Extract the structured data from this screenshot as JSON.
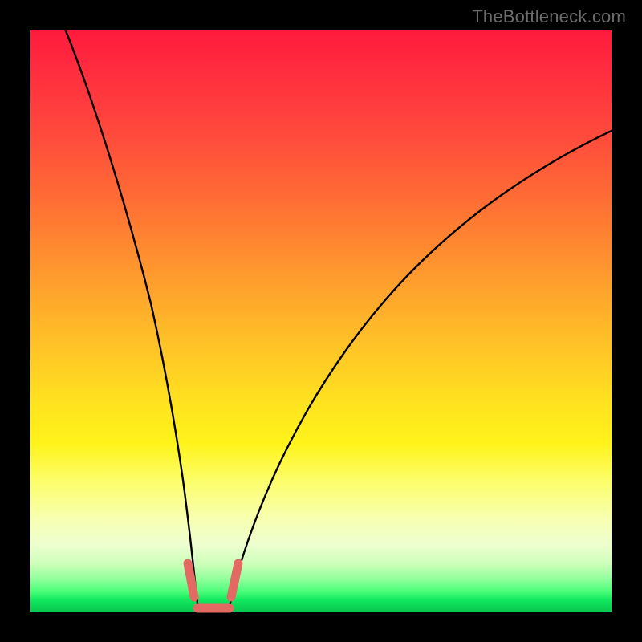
{
  "watermark": "TheBottleneck.com",
  "chart_data": {
    "type": "line",
    "title": "",
    "xlabel": "",
    "ylabel": "",
    "xlim": [
      0,
      100
    ],
    "ylim": [
      0,
      100
    ],
    "series": [
      {
        "name": "left-branch",
        "x": [
          6,
          8,
          10,
          12,
          14,
          16,
          18,
          20,
          22,
          23,
          24,
          25,
          25.8,
          26.5,
          27,
          27.3
        ],
        "y": [
          100,
          93,
          86,
          78,
          70,
          62,
          53,
          43,
          32,
          26,
          20,
          14,
          9,
          5,
          2,
          0
        ]
      },
      {
        "name": "right-branch",
        "x": [
          32.5,
          33,
          34,
          35.5,
          38,
          41,
          45,
          50,
          56,
          62,
          69,
          76,
          84,
          92,
          100
        ],
        "y": [
          0,
          2,
          6,
          11,
          18,
          26,
          34,
          43,
          51,
          58,
          64,
          70,
          75,
          80,
          84
        ]
      }
    ],
    "highlight_segments": [
      {
        "name": "left-bottom-marker",
        "x": [
          25.3,
          26.8
        ],
        "y": [
          7.0,
          1.8
        ]
      },
      {
        "name": "right-bottom-marker",
        "x": [
          32.8,
          34.4
        ],
        "y": [
          2.0,
          7.0
        ]
      },
      {
        "name": "valley-bridge",
        "x": [
          27.0,
          32.6
        ],
        "y": [
          0.4,
          0.4
        ]
      }
    ],
    "colors": {
      "curve": "#000000",
      "marker": "#e36a63",
      "gradient_top": "#ff1a3d",
      "gradient_bottom": "#09c84f"
    }
  }
}
